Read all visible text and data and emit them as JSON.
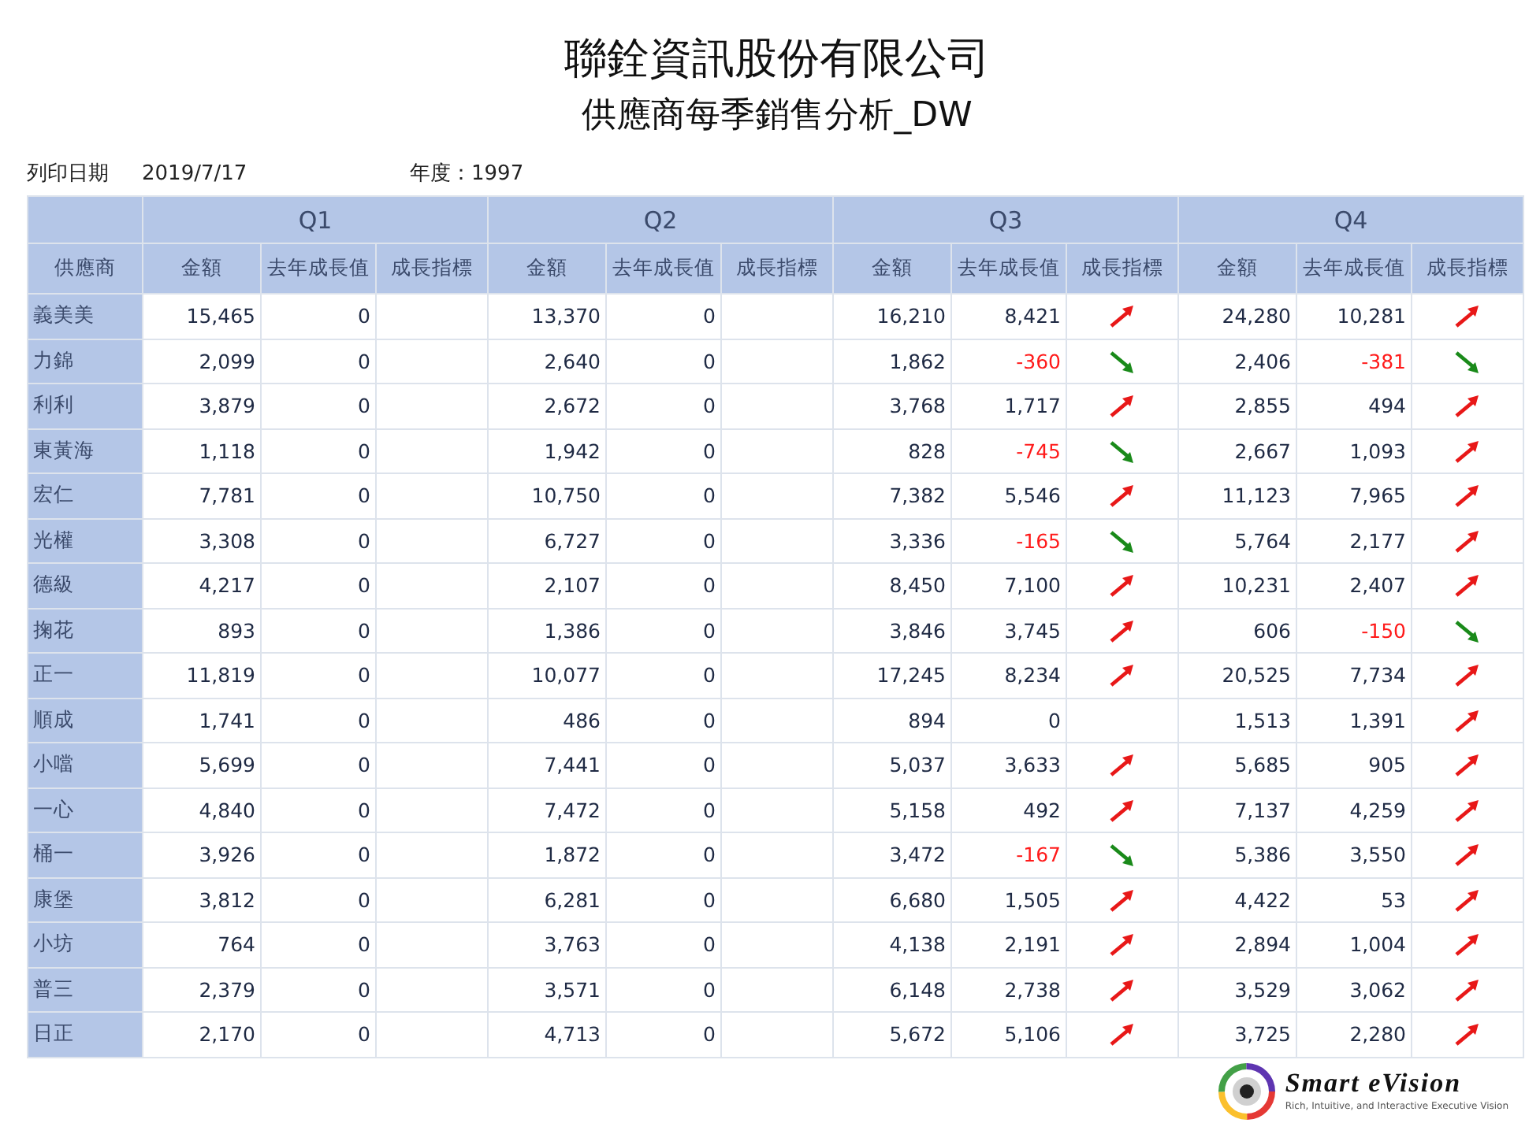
{
  "title": "聯銓資訊股份有限公司",
  "subtitle": "供應商每季銷售分析_DW",
  "print_date": {
    "label": "列印日期",
    "value": "2019/7/17"
  },
  "year": {
    "label": "年度：",
    "value": "1997"
  },
  "table": {
    "supplier_column": "供應商",
    "quarters": [
      {
        "label": "Q1",
        "columns": [
          "金額",
          "去年成長值",
          "成長指標"
        ]
      },
      {
        "label": "Q2",
        "columns": [
          "金額",
          "去年成長值",
          "成長指標"
        ]
      },
      {
        "label": "Q3",
        "columns": [
          "金額",
          "去年成長值",
          "成長指標"
        ]
      },
      {
        "label": "Q4",
        "columns": [
          "金額",
          "去年成長值",
          "成長指標"
        ]
      }
    ],
    "rows": [
      {
        "supplier": "義美美",
        "quarters": [
          {
            "amount": "15,465",
            "growth": "0",
            "kind": "none"
          },
          {
            "amount": "13,370",
            "growth": "0",
            "kind": "none"
          },
          {
            "amount": "16,210",
            "growth": "8,421",
            "kind": "up"
          },
          {
            "amount": "24,280",
            "growth": "10,281",
            "kind": "up"
          }
        ]
      },
      {
        "supplier": "力錦",
        "quarters": [
          {
            "amount": "2,099",
            "growth": "0",
            "kind": "none"
          },
          {
            "amount": "2,640",
            "growth": "0",
            "kind": "none"
          },
          {
            "amount": "1,862",
            "growth": "-360",
            "kind": "down"
          },
          {
            "amount": "2,406",
            "growth": "-381",
            "kind": "down"
          }
        ]
      },
      {
        "supplier": "利利",
        "quarters": [
          {
            "amount": "3,879",
            "growth": "0",
            "kind": "none"
          },
          {
            "amount": "2,672",
            "growth": "0",
            "kind": "none"
          },
          {
            "amount": "3,768",
            "growth": "1,717",
            "kind": "up"
          },
          {
            "amount": "2,855",
            "growth": "494",
            "kind": "up"
          }
        ]
      },
      {
        "supplier": "東黃海",
        "quarters": [
          {
            "amount": "1,118",
            "growth": "0",
            "kind": "none"
          },
          {
            "amount": "1,942",
            "growth": "0",
            "kind": "none"
          },
          {
            "amount": "828",
            "growth": "-745",
            "kind": "down"
          },
          {
            "amount": "2,667",
            "growth": "1,093",
            "kind": "up"
          }
        ]
      },
      {
        "supplier": "宏仁",
        "quarters": [
          {
            "amount": "7,781",
            "growth": "0",
            "kind": "none"
          },
          {
            "amount": "10,750",
            "growth": "0",
            "kind": "none"
          },
          {
            "amount": "7,382",
            "growth": "5,546",
            "kind": "up"
          },
          {
            "amount": "11,123",
            "growth": "7,965",
            "kind": "up"
          }
        ]
      },
      {
        "supplier": "光權",
        "quarters": [
          {
            "amount": "3,308",
            "growth": "0",
            "kind": "none"
          },
          {
            "amount": "6,727",
            "growth": "0",
            "kind": "none"
          },
          {
            "amount": "3,336",
            "growth": "-165",
            "kind": "down"
          },
          {
            "amount": "5,764",
            "growth": "2,177",
            "kind": "up"
          }
        ]
      },
      {
        "supplier": "德級",
        "quarters": [
          {
            "amount": "4,217",
            "growth": "0",
            "kind": "none"
          },
          {
            "amount": "2,107",
            "growth": "0",
            "kind": "none"
          },
          {
            "amount": "8,450",
            "growth": "7,100",
            "kind": "up"
          },
          {
            "amount": "10,231",
            "growth": "2,407",
            "kind": "up"
          }
        ]
      },
      {
        "supplier": "掬花",
        "quarters": [
          {
            "amount": "893",
            "growth": "0",
            "kind": "none"
          },
          {
            "amount": "1,386",
            "growth": "0",
            "kind": "none"
          },
          {
            "amount": "3,846",
            "growth": "3,745",
            "kind": "up"
          },
          {
            "amount": "606",
            "growth": "-150",
            "kind": "down"
          }
        ]
      },
      {
        "supplier": "正一",
        "quarters": [
          {
            "amount": "11,819",
            "growth": "0",
            "kind": "none"
          },
          {
            "amount": "10,077",
            "growth": "0",
            "kind": "none"
          },
          {
            "amount": "17,245",
            "growth": "8,234",
            "kind": "up"
          },
          {
            "amount": "20,525",
            "growth": "7,734",
            "kind": "up"
          }
        ]
      },
      {
        "supplier": "順成",
        "quarters": [
          {
            "amount": "1,741",
            "growth": "0",
            "kind": "none"
          },
          {
            "amount": "486",
            "growth": "0",
            "kind": "none"
          },
          {
            "amount": "894",
            "growth": "0",
            "kind": "none"
          },
          {
            "amount": "1,513",
            "growth": "1,391",
            "kind": "up"
          }
        ]
      },
      {
        "supplier": "小噹",
        "quarters": [
          {
            "amount": "5,699",
            "growth": "0",
            "kind": "none"
          },
          {
            "amount": "7,441",
            "growth": "0",
            "kind": "none"
          },
          {
            "amount": "5,037",
            "growth": "3,633",
            "kind": "up"
          },
          {
            "amount": "5,685",
            "growth": "905",
            "kind": "up"
          }
        ]
      },
      {
        "supplier": "一心",
        "quarters": [
          {
            "amount": "4,840",
            "growth": "0",
            "kind": "none"
          },
          {
            "amount": "7,472",
            "growth": "0",
            "kind": "none"
          },
          {
            "amount": "5,158",
            "growth": "492",
            "kind": "up"
          },
          {
            "amount": "7,137",
            "growth": "4,259",
            "kind": "up"
          }
        ]
      },
      {
        "supplier": "桶一",
        "quarters": [
          {
            "amount": "3,926",
            "growth": "0",
            "kind": "none"
          },
          {
            "amount": "1,872",
            "growth": "0",
            "kind": "none"
          },
          {
            "amount": "3,472",
            "growth": "-167",
            "kind": "down"
          },
          {
            "amount": "5,386",
            "growth": "3,550",
            "kind": "up"
          }
        ]
      },
      {
        "supplier": "康堡",
        "quarters": [
          {
            "amount": "3,812",
            "growth": "0",
            "kind": "none"
          },
          {
            "amount": "6,281",
            "growth": "0",
            "kind": "none"
          },
          {
            "amount": "6,680",
            "growth": "1,505",
            "kind": "up"
          },
          {
            "amount": "4,422",
            "growth": "53",
            "kind": "up"
          }
        ]
      },
      {
        "supplier": "小坊",
        "quarters": [
          {
            "amount": "764",
            "growth": "0",
            "kind": "none"
          },
          {
            "amount": "3,763",
            "growth": "0",
            "kind": "none"
          },
          {
            "amount": "4,138",
            "growth": "2,191",
            "kind": "up"
          },
          {
            "amount": "2,894",
            "growth": "1,004",
            "kind": "up"
          }
        ]
      },
      {
        "supplier": "普三",
        "quarters": [
          {
            "amount": "2,379",
            "growth": "0",
            "kind": "none"
          },
          {
            "amount": "3,571",
            "growth": "0",
            "kind": "none"
          },
          {
            "amount": "6,148",
            "growth": "2,738",
            "kind": "up"
          },
          {
            "amount": "3,529",
            "growth": "3,062",
            "kind": "up"
          }
        ]
      },
      {
        "supplier": "日正",
        "quarters": [
          {
            "amount": "2,170",
            "growth": "0",
            "kind": "none"
          },
          {
            "amount": "4,713",
            "growth": "0",
            "kind": "none"
          },
          {
            "amount": "5,672",
            "growth": "5,106",
            "kind": "up"
          },
          {
            "amount": "3,725",
            "growth": "2,280",
            "kind": "up"
          }
        ]
      }
    ]
  },
  "logo": {
    "name": "Smart eVision",
    "tagline": "Rich, Intuitive, and Interactive Executive Vision"
  }
}
